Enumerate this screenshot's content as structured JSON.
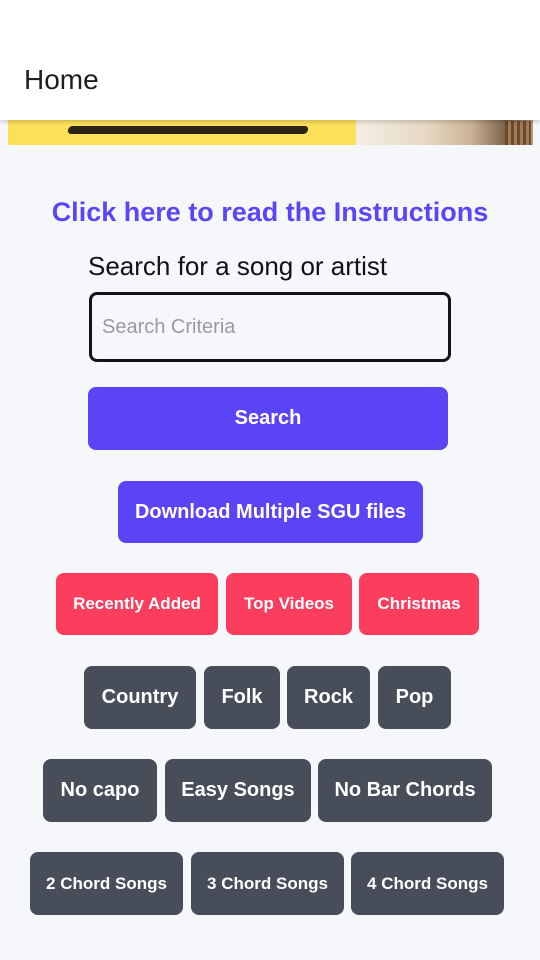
{
  "app_bar": {
    "title": "Home"
  },
  "instructions_link": "Click here to read the Instructions",
  "search": {
    "label": "Search for a song or artist",
    "placeholder": "Search Criteria",
    "value": "",
    "button_label": "Search"
  },
  "download_button_label": "Download Multiple SGU files",
  "category_rows": [
    [
      "Recently Added",
      "Top Videos",
      "Christmas"
    ],
    [
      "Country",
      "Folk",
      "Rock",
      "Pop"
    ],
    [
      "No capo",
      "Easy Songs",
      "No Bar Chords"
    ],
    [
      "2 Chord Songs",
      "3 Chord Songs",
      "4 Chord Songs"
    ]
  ],
  "colors": {
    "accent": "#5a44f5",
    "highlight": "#fb3d5e",
    "neutral_button": "#474e59",
    "background": "#f6f7fb"
  }
}
